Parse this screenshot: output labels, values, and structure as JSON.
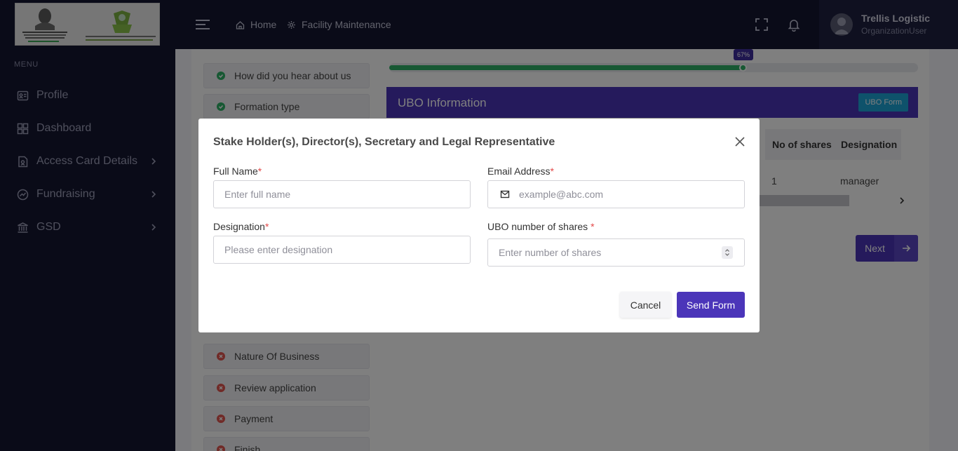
{
  "sidebar": {
    "menu_title": "MENU",
    "items": [
      {
        "label": "Profile",
        "icon": "profile-card-icon",
        "has_chevron": false
      },
      {
        "label": "Dashboard",
        "icon": "dashboard-grid-icon",
        "has_chevron": false
      },
      {
        "label": "Access Card Details",
        "icon": "access-card-icon",
        "has_chevron": true
      },
      {
        "label": "Fundraising",
        "icon": "fundraising-icon",
        "has_chevron": true
      },
      {
        "label": "GSD",
        "icon": "bank-building-icon",
        "has_chevron": true
      }
    ]
  },
  "header": {
    "breadcrumbs": [
      {
        "label": "Home",
        "icon": "home-icon"
      },
      {
        "label": "Facility Maintenance",
        "icon": "gear-icon"
      }
    ],
    "user": {
      "name": "Trellis Logistic",
      "role": "OrganizationUser"
    }
  },
  "steps": [
    {
      "label": "How did you hear about us",
      "status": "complete"
    },
    {
      "label": "Formation type",
      "status": "complete"
    },
    {
      "label": "Nature Of Business",
      "status": "incomplete"
    },
    {
      "label": "Review application",
      "status": "incomplete"
    },
    {
      "label": "Payment",
      "status": "incomplete"
    },
    {
      "label": "Finish",
      "status": "incomplete"
    }
  ],
  "progress": {
    "percent_label": "67%",
    "value": 0.67
  },
  "ubo": {
    "title": "UBO Information",
    "form_button": "UBO Form",
    "columns": [
      "No of shares",
      "Designation"
    ],
    "row": [
      "1",
      "manager"
    ]
  },
  "next_button": "Next",
  "modal": {
    "title": "Stake Holder(s), Director(s), Secretary and Legal Representative",
    "fields": {
      "full_name": {
        "label": "Full Name",
        "required_mark": "*",
        "placeholder": "Enter full name"
      },
      "email": {
        "label": "Email Address",
        "required_mark": "*",
        "placeholder": "example@abc.com"
      },
      "designation": {
        "label": "Designation",
        "required_mark": "*",
        "placeholder": "Please enter designation"
      },
      "shares": {
        "label": "UBO number of shares ",
        "required_mark": "*",
        "placeholder": "Enter number of shares"
      }
    },
    "cancel_label": "Cancel",
    "send_label": "Send Form"
  },
  "colors": {
    "sidebar_bg": "#151630",
    "accent": "#4b35b9",
    "success": "#2eb067",
    "danger": "#e0544e",
    "info": "#1da4d6"
  }
}
